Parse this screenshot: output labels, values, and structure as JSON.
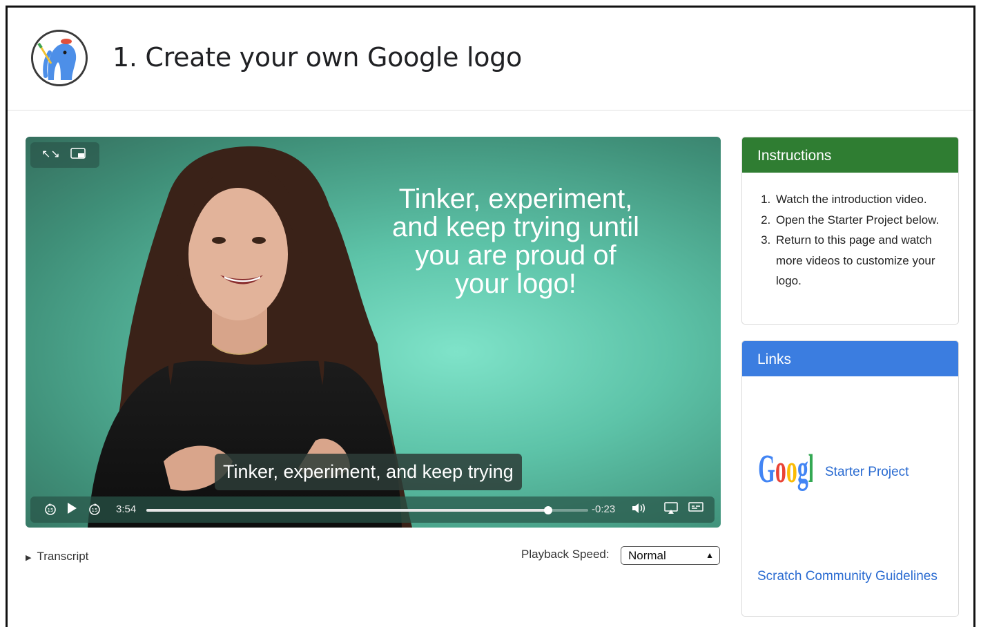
{
  "header": {
    "title": "1. Create your own Google logo",
    "logo_icon": "scratch-elephant-logo-icon"
  },
  "video": {
    "overlay_text_lines": [
      "Tinker, experiment,",
      "and keep trying until",
      "you are proud of",
      "your logo!"
    ],
    "caption": "Tinker, experiment, and keep trying",
    "elapsed": "3:54",
    "remaining": "-0:23",
    "progress": 0.91,
    "top_controls": {
      "fullscreen_icon": "fullscreen-icon",
      "pip_icon": "picture-in-picture-icon"
    },
    "controls": {
      "rewind_icon": "rewind-15-icon",
      "play_icon": "play-icon",
      "forward_icon": "forward-15-icon",
      "volume_icon": "volume-icon",
      "airplay_icon": "airplay-icon",
      "captions_icon": "captions-icon"
    }
  },
  "below_video": {
    "transcript_label": "Transcript",
    "playback_speed_label": "Playback Speed:",
    "playback_speed_value": "Normal"
  },
  "instructions": {
    "title": "Instructions",
    "steps": [
      "Watch the introduction video.",
      "Open the Starter Project below.",
      "Return to this page and watch more videos to customize your logo."
    ],
    "header_color": "#2f7d32"
  },
  "links": {
    "title": "Links",
    "header_color": "#3b7de0",
    "starter_project": "Starter Project",
    "guidelines": "Scratch Community Guidelines"
  }
}
